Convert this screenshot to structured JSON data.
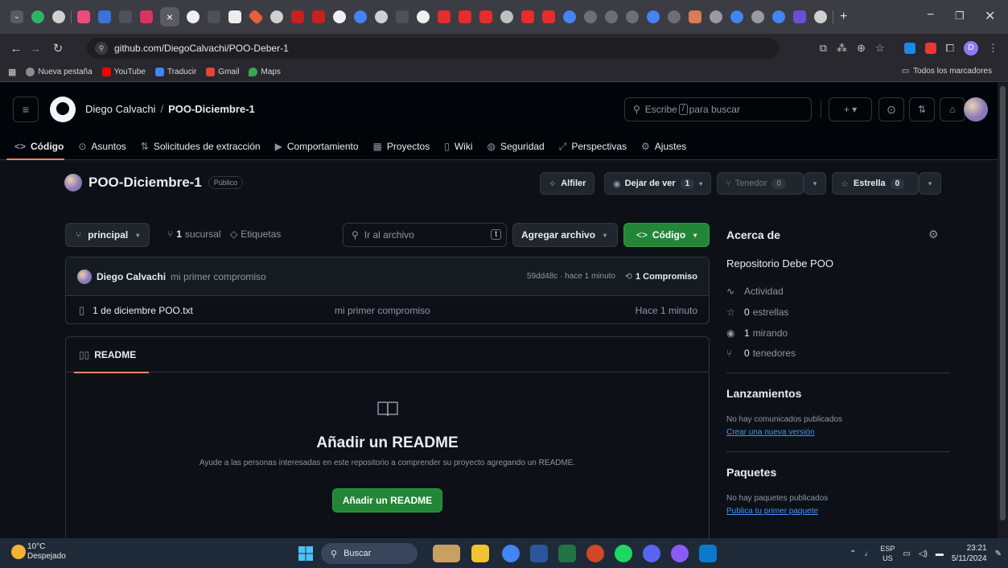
{
  "browser": {
    "url": "github.com/DiegoCalvachi/POO-Deber-1",
    "bookmarks": [
      "Nueva pestaña",
      "YouTube",
      "Traducir",
      "Gmail",
      "Maps"
    ],
    "all_bookmarks": "Todos los marcadores",
    "profile_initial": "D"
  },
  "header": {
    "owner": "Diego Calvachi",
    "separator": "/",
    "repo": "POO-Diciembre-1",
    "search_prefix": "Escribe",
    "search_slash": "/",
    "search_suffix": "para buscar",
    "plus": "+ ▾"
  },
  "repo_nav": {
    "items": [
      {
        "icon": "<>",
        "label": "Código"
      },
      {
        "icon": "⊙",
        "label": "Asuntos"
      },
      {
        "icon": "⇅",
        "label": "Solicitudes de extracción"
      },
      {
        "icon": "▶",
        "label": "Comportamiento"
      },
      {
        "icon": "▦",
        "label": "Proyectos"
      },
      {
        "icon": "▯",
        "label": "Wiki"
      },
      {
        "icon": "◍",
        "label": "Seguridad"
      },
      {
        "icon": "⤢",
        "label": "Perspectivas"
      },
      {
        "icon": "⚙",
        "label": "Ajustes"
      }
    ]
  },
  "repo": {
    "name": "POO-Diciembre-1",
    "visibility": "Público",
    "pin": "Alfiler",
    "watch": "Dejar de ver",
    "watch_count": "1",
    "fork": "Tenedor",
    "fork_count": "0",
    "star": "Estrella",
    "star_count": "0"
  },
  "toolbar": {
    "branch": "principal",
    "branches_count": "1",
    "branches_label": "sucursal",
    "tags": "Etiquetas",
    "goto_placeholder": "Ir al archivo",
    "goto_key": "t",
    "add_file": "Agregar archivo",
    "code": "Código"
  },
  "commit": {
    "author": "Diego Calvachi",
    "message": "mi primer compromiso",
    "meta": "59dd48c · hace 1 minuto",
    "count": "1 Compromiso"
  },
  "files": [
    {
      "name": "1 de diciembre POO.txt",
      "message": "mi primer compromiso",
      "time": "Hace 1 minuto"
    }
  ],
  "readme": {
    "tab": "README",
    "title": "Añadir un README",
    "description": "Ayude a las personas interesadas en este repositorio a comprender su proyecto agregando un README.",
    "button": "Añadir un README"
  },
  "about": {
    "heading": "Acerca de",
    "description": "Repositorio Debe POO",
    "activity": "Actividad",
    "stars_value": "0",
    "stars_label": "estrellas",
    "watching_value": "1",
    "watching_label": "mirando",
    "forks_value": "0",
    "forks_label": "tenedores"
  },
  "releases": {
    "heading": "Lanzamientos",
    "empty": "No hay comunicados publicados",
    "link": "Crear una nueva versión"
  },
  "packages": {
    "heading": "Paquetes",
    "empty": "No hay paquetes publicados",
    "link": "Publica tu primer paquete"
  },
  "taskbar": {
    "temperature": "10°C",
    "weather": "Despejado",
    "search": "Buscar",
    "lang_top": "ESP",
    "lang_bottom": "US",
    "time": "23:21",
    "date": "5/11/2024"
  },
  "colors": {
    "accent_green": "#238636",
    "tab_underline": "#f78166",
    "link": "#4493f8",
    "bg": "#0d1117"
  }
}
